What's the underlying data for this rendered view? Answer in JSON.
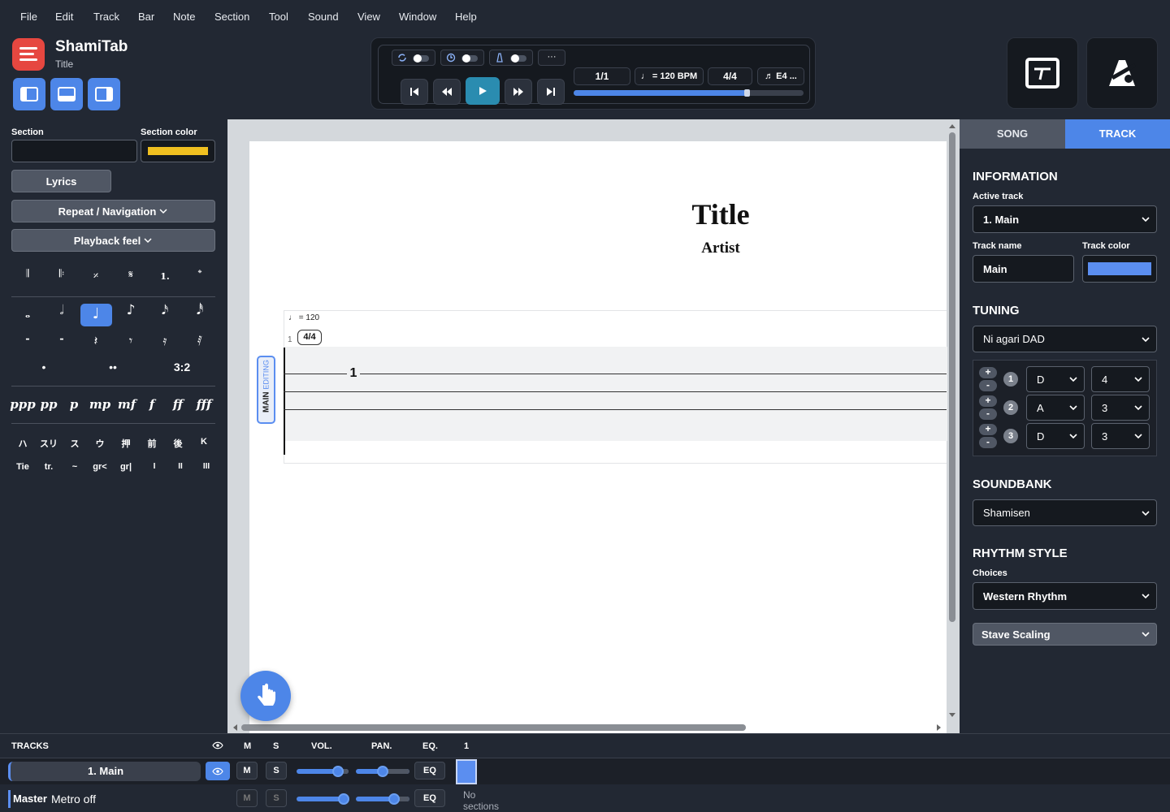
{
  "menu": [
    "File",
    "Edit",
    "Track",
    "Bar",
    "Note",
    "Section",
    "Tool",
    "Sound",
    "View",
    "Window",
    "Help"
  ],
  "app": {
    "name": "ShamiTab",
    "subtitle": "Title"
  },
  "transport": {
    "bar": "1/1",
    "tempo": "♩ = 120 BPM",
    "time_sig": "4/4",
    "tuning": "♬ E4 ...",
    "more": "···",
    "progress": 0.76
  },
  "left": {
    "section_label": "Section",
    "section_value": "",
    "section_color_label": "Section color",
    "section_color": "#f0c020",
    "lyrics_button": "Lyrics",
    "repeat_button": "Repeat / Navigation",
    "playback_button": "Playback feel",
    "marks": [
      "𝄂",
      "𝄆",
      "𝄎",
      "𝄋",
      "1.",
      "𝄌"
    ],
    "durations": [
      "𝅝",
      "𝅗𝅥",
      "♩",
      "♪",
      "𝅘𝅥𝅯",
      "𝅘𝅥𝅰"
    ],
    "rests": [
      "-",
      "-",
      "𝄽",
      "𝄾",
      "𝄿",
      "𝅀"
    ],
    "dots": [
      "•",
      "••",
      "3:2"
    ],
    "dynamics": [
      "ppp",
      "pp",
      "p",
      "mp",
      "mf",
      "f",
      "ff",
      "fff"
    ],
    "techniques_row1": [
      "ハ",
      "スリ",
      "ス",
      "ウ",
      "押",
      "前",
      "後",
      "K"
    ],
    "techniques_row2": [
      "Tie",
      "tr.",
      "~",
      "gr<",
      "gr|",
      "I",
      "II",
      "III"
    ]
  },
  "score": {
    "title": "Title",
    "artist": "Artist",
    "tempo_mark": "♩ = 120",
    "bar_number": "1",
    "time_sig": "4/4",
    "fret": "1",
    "track_tab_main": "MAIN",
    "track_tab_editing": "EDITING"
  },
  "right": {
    "tabs": {
      "song": "SONG",
      "track": "TRACK"
    },
    "information": "INFORMATION",
    "active_track_label": "Active track",
    "active_track": "1. Main",
    "track_name_label": "Track name",
    "track_name": "Main",
    "track_color_label": "Track color",
    "track_color": "#5b8ef0",
    "tuning_heading": "TUNING",
    "tuning_preset": "Ni agari DAD",
    "strings": [
      {
        "n": "1",
        "note": "D",
        "octave": "4"
      },
      {
        "n": "2",
        "note": "A",
        "octave": "3"
      },
      {
        "n": "3",
        "note": "D",
        "octave": "3"
      }
    ],
    "soundbank_heading": "SOUNDBANK",
    "soundbank": "Shamisen",
    "rhythm_heading": "RHYTHM STYLE",
    "choices_label": "Choices",
    "rhythm_choice": "Western Rhythm",
    "stave_scaling": "Stave Scaling"
  },
  "tracks": {
    "heading": "TRACKS",
    "col_m": "M",
    "col_s": "S",
    "col_vol": "VOL.",
    "col_pan": "PAN.",
    "col_eq": "EQ.",
    "col_bar": "1",
    "rows": [
      {
        "name": "1. Main",
        "m": "M",
        "s": "S",
        "eq": "EQ",
        "vol": 0.8,
        "pan": 0.5
      }
    ],
    "master": {
      "label": "Master",
      "metro": "Metro off",
      "m": "M",
      "s": "S",
      "eq": "EQ",
      "vol": 0.95,
      "pan": 0.75,
      "no_sections": "No sections"
    }
  }
}
